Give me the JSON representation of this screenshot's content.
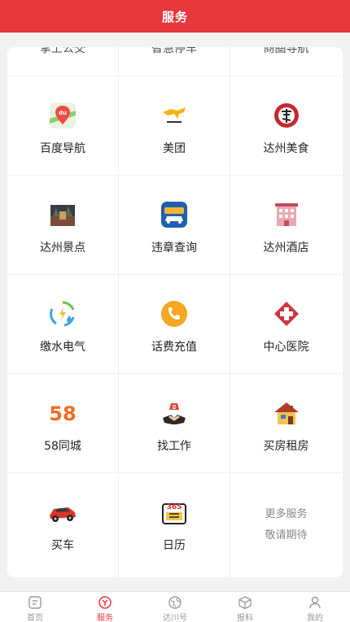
{
  "header": {
    "title": "服务"
  },
  "partial_row": [
    {
      "label": "掌上公交"
    },
    {
      "label": "智慧停车"
    },
    {
      "label": "商圈导航"
    }
  ],
  "services": [
    {
      "label": "百度导航",
      "icon": "baidu-map-icon"
    },
    {
      "label": "美团",
      "icon": "meituan-icon"
    },
    {
      "label": "达州美食",
      "icon": "food-icon"
    },
    {
      "label": "达州景点",
      "icon": "scenic-icon"
    },
    {
      "label": "违章查询",
      "icon": "traffic-violation-icon"
    },
    {
      "label": "达州酒店",
      "icon": "hotel-icon"
    },
    {
      "label": "缴水电气",
      "icon": "utilities-icon"
    },
    {
      "label": "话费充值",
      "icon": "phone-recharge-icon"
    },
    {
      "label": "中心医院",
      "icon": "hospital-icon"
    },
    {
      "label": "58同城",
      "icon": "58-icon",
      "logo_text": "58"
    },
    {
      "label": "找工作",
      "icon": "job-icon"
    },
    {
      "label": "买房租房",
      "icon": "house-icon"
    },
    {
      "label": "买车",
      "icon": "car-icon"
    },
    {
      "label": "日历",
      "icon": "calendar-icon",
      "logo_text": "365"
    }
  ],
  "more": {
    "line1": "更多服务",
    "line2": "敬请期待"
  },
  "tabs": [
    {
      "label": "首页",
      "icon": "home-icon",
      "active": false
    },
    {
      "label": "服务",
      "icon": "service-icon",
      "active": true
    },
    {
      "label": "达川号",
      "icon": "globe-icon",
      "active": false
    },
    {
      "label": "报料",
      "icon": "box-icon",
      "active": false
    },
    {
      "label": "我的",
      "icon": "user-icon",
      "active": false
    }
  ],
  "colors": {
    "brand": "#e8383d",
    "tab_inactive": "#999999"
  }
}
